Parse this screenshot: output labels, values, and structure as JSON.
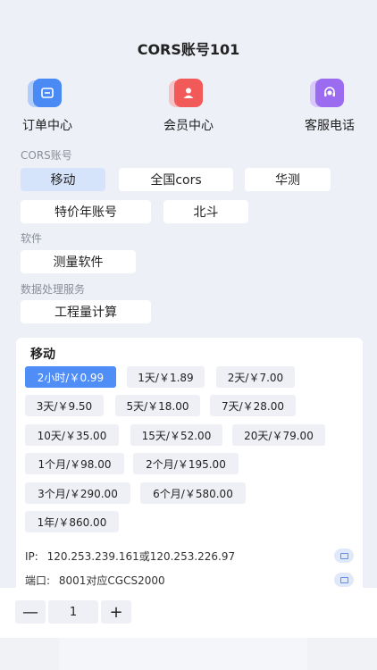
{
  "title": "CORS账号101",
  "quick_actions": [
    {
      "label": "订单中心",
      "icon": "order-icon",
      "color": "#4a8af4"
    },
    {
      "label": "会员中心",
      "icon": "member-icon",
      "color": "#f25a5a"
    },
    {
      "label": "客服电话",
      "icon": "customer-service-icon",
      "color": "#9b6bf0"
    }
  ],
  "sections": {
    "cors": {
      "label": "CORS账号",
      "items": [
        "移动",
        "全国cors",
        "华测",
        "特价年账号",
        "北斗"
      ],
      "selected": "移动"
    },
    "software": {
      "label": "软件",
      "items": [
        "测量软件"
      ]
    },
    "data_service": {
      "label": "数据处理服务",
      "items": [
        "工程量计算"
      ]
    }
  },
  "plan_card": {
    "title": "移动",
    "prices": [
      "2小时/￥0.99",
      "1天/￥1.89",
      "2天/￥7.00",
      "3天/￥9.50",
      "5天/￥18.00",
      "7天/￥28.00",
      "10天/￥35.00",
      "15天/￥52.00",
      "20天/￥79.00",
      "1个月/￥98.00",
      "2个月/￥195.00",
      "3个月/￥290.00",
      "6个月/￥580.00",
      "1年/￥860.00"
    ],
    "selected": "2小时/￥0.99",
    "ip_label": "IP:",
    "ip_value": "120.253.239.161或120.253.226.97",
    "port_label": "端口:",
    "port_value": "8001对应CGCS2000"
  },
  "quantity": {
    "minus": "—",
    "value": "1",
    "plus": "+"
  },
  "colors": {
    "accent": "#4f8ef7",
    "active_chip": "#d6e4fb",
    "background": "#eef0f8"
  }
}
